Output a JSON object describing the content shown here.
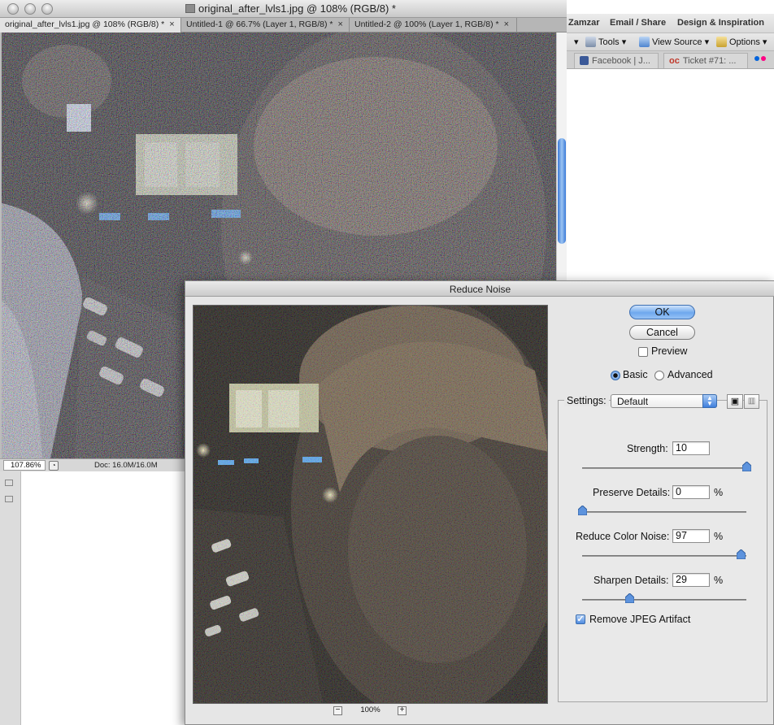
{
  "browser": {
    "menu_items": [
      "Zamzar",
      "Email / Share",
      "Design & Inspiration"
    ],
    "toolbar": {
      "tools_label": "Tools",
      "view_source_label": "View Source",
      "options_label": "Options"
    },
    "tabs": [
      {
        "label": "Facebook | J..."
      },
      {
        "label": "Ticket #71: ..."
      }
    ]
  },
  "document": {
    "title": "original_after_lvls1.jpg @ 108% (RGB/8) *",
    "tabs": [
      {
        "label": "original_after_lvls1.jpg @ 108% (RGB/8) *",
        "active": true
      },
      {
        "label": "Untitled-1 @ 66.7% (Layer 1, RGB/8) *",
        "active": false
      },
      {
        "label": "Untitled-2 @ 100% (Layer 1, RGB/8) *",
        "active": false
      }
    ],
    "close_glyph": "×",
    "zoom": "107.86%",
    "doc_size": "Doc: 16.0M/16.0M"
  },
  "dialog": {
    "title": "Reduce Noise",
    "ok_label": "OK",
    "cancel_label": "Cancel",
    "preview_label": "Preview",
    "preview_checked": false,
    "mode_options": [
      "Basic",
      "Advanced"
    ],
    "mode_selected": "Basic",
    "settings_label": "Settings:",
    "settings_value": "Default",
    "zoom_level": "100%",
    "zoom_out_glyph": "−",
    "zoom_in_glyph": "+",
    "controls": {
      "strength": {
        "label": "Strength:",
        "value": "10",
        "max": 10,
        "unit": ""
      },
      "preserve_details": {
        "label": "Preserve Details:",
        "value": "0",
        "max": 100,
        "unit": "%"
      },
      "reduce_color_noise": {
        "label": "Reduce Color Noise:",
        "value": "97",
        "max": 100,
        "unit": "%"
      },
      "sharpen_details": {
        "label": "Sharpen Details:",
        "value": "29",
        "max": 100,
        "unit": "%"
      }
    },
    "remove_jpeg_label": "Remove JPEG Artifact",
    "remove_jpeg_checked": true
  },
  "colors": {
    "accent_blue": "#4f8be0",
    "default_button": "#6ea8ee",
    "scroll_thumb": "#3b7ad8"
  }
}
